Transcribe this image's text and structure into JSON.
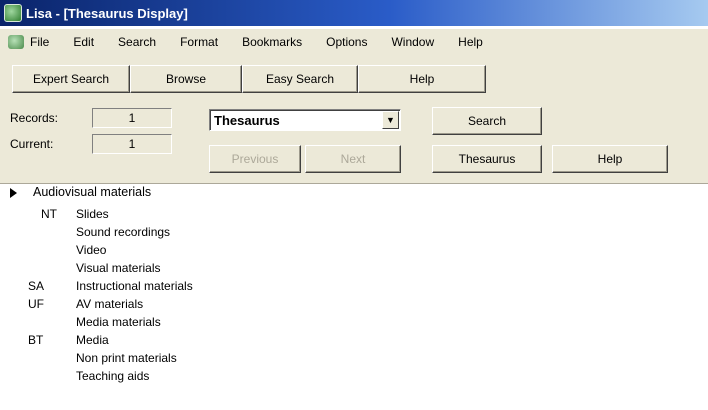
{
  "window": {
    "title": "Lisa - [Thesaurus Display]"
  },
  "menu": {
    "items": [
      "File",
      "Edit",
      "Search",
      "Format",
      "Bookmarks",
      "Options",
      "Window",
      "Help"
    ]
  },
  "toolbar": {
    "expert_search": "Expert Search",
    "browse": "Browse",
    "easy_search": "Easy Search",
    "help": "Help"
  },
  "records": {
    "label": "Records:",
    "value": "1"
  },
  "current": {
    "label": "Current:",
    "value": "1"
  },
  "selector": {
    "selected": "Thesaurus"
  },
  "buttons": {
    "previous": "Previous",
    "next": "Next",
    "search": "Search",
    "thesaurus": "Thesaurus",
    "help": "Help"
  },
  "thesaurus": {
    "term": "Audiovisual materials",
    "relations": [
      {
        "code": "NT",
        "terms": [
          "Slides",
          "Sound recordings",
          "Video",
          "Visual materials"
        ]
      },
      {
        "code": "SA",
        "terms": [
          "Instructional materials"
        ]
      },
      {
        "code": "UF",
        "terms": [
          "AV materials",
          "Media materials"
        ]
      },
      {
        "code": "BT",
        "terms": [
          "Media",
          "Non print materials",
          "Teaching aids"
        ]
      }
    ]
  }
}
